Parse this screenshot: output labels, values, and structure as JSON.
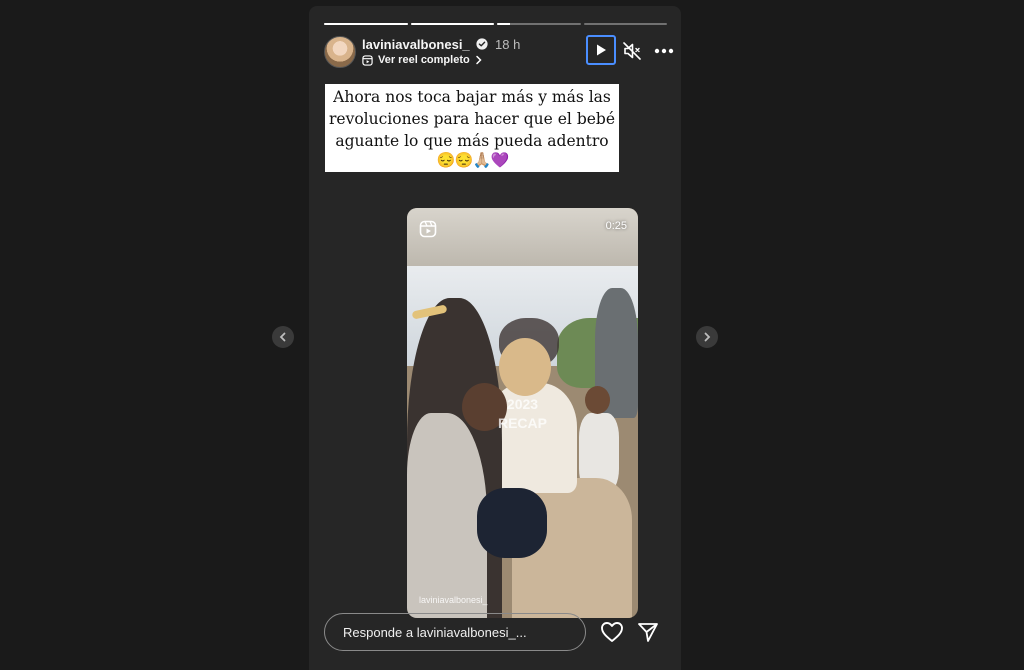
{
  "story": {
    "progress": [
      1,
      1,
      0.15,
      0,
      0
    ],
    "user": {
      "username": "laviniavalbonesi_",
      "verified": true,
      "time_ago": "18 h"
    },
    "reel_link": "Ver reel completo",
    "controls": {
      "play_icon": "play-icon",
      "mute_icon": "mute-icon",
      "more_icon": "more-icon"
    },
    "caption": {
      "line1": "Ahora nos toca bajar más y más las",
      "line2": "revoluciones para hacer que el bebé",
      "line3": "aguante lo que más pueda adentro",
      "emojis": [
        "😔",
        "😔",
        "🙏🏼",
        "💜"
      ]
    },
    "reel": {
      "duration": "0:25",
      "overlay_line1": "2023",
      "overlay_line2": "RECAP",
      "watermark": "laviniavalbonesi_"
    },
    "reply": {
      "placeholder": "Responde a laviniavalbonesi_..."
    }
  },
  "accent_color": "#4a8eff"
}
